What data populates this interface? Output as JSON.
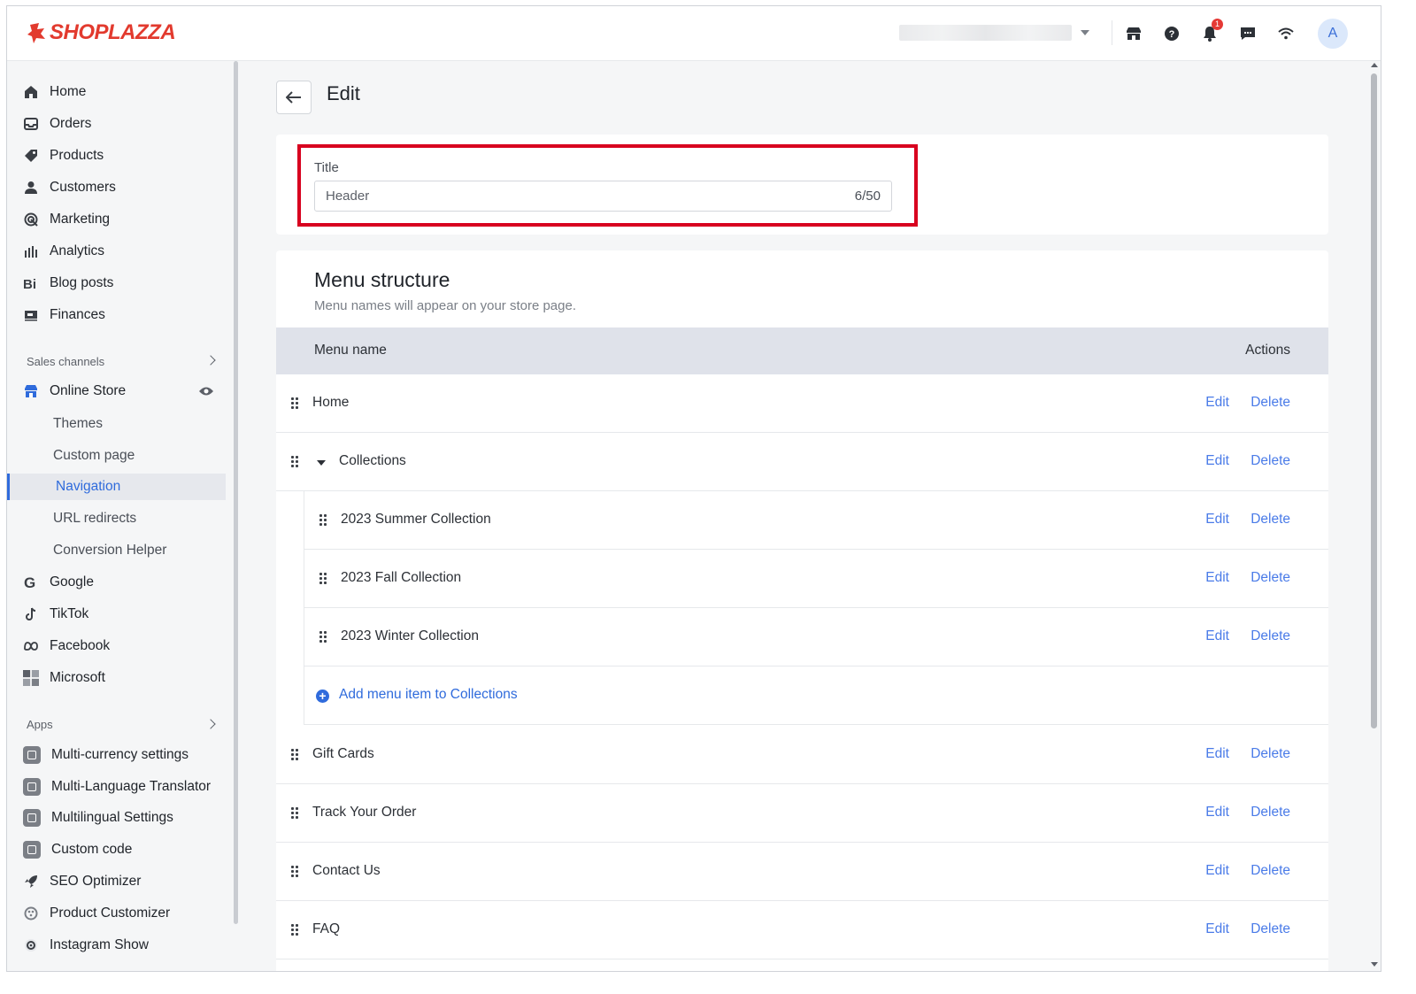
{
  "brand": {
    "name": "SHOPLAZZA",
    "color": "#e23a2e"
  },
  "topbar": {
    "notification_count": "1",
    "avatar_initial": "A",
    "icons": [
      "store-icon",
      "help-icon",
      "bell-icon",
      "chat-icon",
      "wifi-icon"
    ]
  },
  "sidebar": {
    "main": [
      {
        "label": "Home",
        "icon": "home-icon"
      },
      {
        "label": "Orders",
        "icon": "inbox-icon"
      },
      {
        "label": "Products",
        "icon": "tag-icon"
      },
      {
        "label": "Customers",
        "icon": "person-icon"
      },
      {
        "label": "Marketing",
        "icon": "target-icon"
      },
      {
        "label": "Analytics",
        "icon": "bar-chart-icon"
      },
      {
        "label": "Blog posts",
        "icon": "blog-icon"
      },
      {
        "label": "Finances",
        "icon": "finance-icon"
      }
    ],
    "sales_channels_label": "Sales channels",
    "online_store": {
      "label": "Online Store",
      "subitems": [
        "Themes",
        "Custom page",
        "Navigation",
        "URL redirects",
        "Conversion Helper"
      ],
      "active": "Navigation"
    },
    "channels": [
      {
        "label": "Google",
        "icon": "google-icon"
      },
      {
        "label": "TikTok",
        "icon": "tiktok-icon"
      },
      {
        "label": "Facebook",
        "icon": "meta-icon"
      },
      {
        "label": "Microsoft",
        "icon": "microsoft-icon"
      }
    ],
    "apps_label": "Apps",
    "apps": [
      {
        "label": "Multi-currency settings"
      },
      {
        "label": "Multi-Language Translator"
      },
      {
        "label": "Multilingual Settings"
      },
      {
        "label": "Custom code"
      },
      {
        "label": "SEO Optimizer"
      },
      {
        "label": "Product Customizer"
      },
      {
        "label": "Instagram Show"
      }
    ]
  },
  "page": {
    "title": "Edit",
    "title_field": {
      "label": "Title",
      "value": "Header",
      "counter": "6/50"
    }
  },
  "menu_structure": {
    "heading": "Menu structure",
    "subheading": "Menu names will appear on your store page.",
    "col_name": "Menu name",
    "col_actions": "Actions",
    "edit_label": "Edit",
    "delete_label": "Delete",
    "items": [
      {
        "name": "Home"
      },
      {
        "name": "Collections",
        "expanded": true,
        "children": [
          {
            "name": "2023 Summer Collection"
          },
          {
            "name": "2023 Fall Collection"
          },
          {
            "name": "2023 Winter Collection"
          }
        ],
        "add_label": "Add menu item to Collections"
      },
      {
        "name": "Gift Cards"
      },
      {
        "name": "Track Your Order"
      },
      {
        "name": "Contact Us"
      },
      {
        "name": "FAQ"
      }
    ]
  },
  "colors": {
    "accent": "#2f6bdc",
    "link": "#4a7be8",
    "highlight": "#d8001f"
  }
}
